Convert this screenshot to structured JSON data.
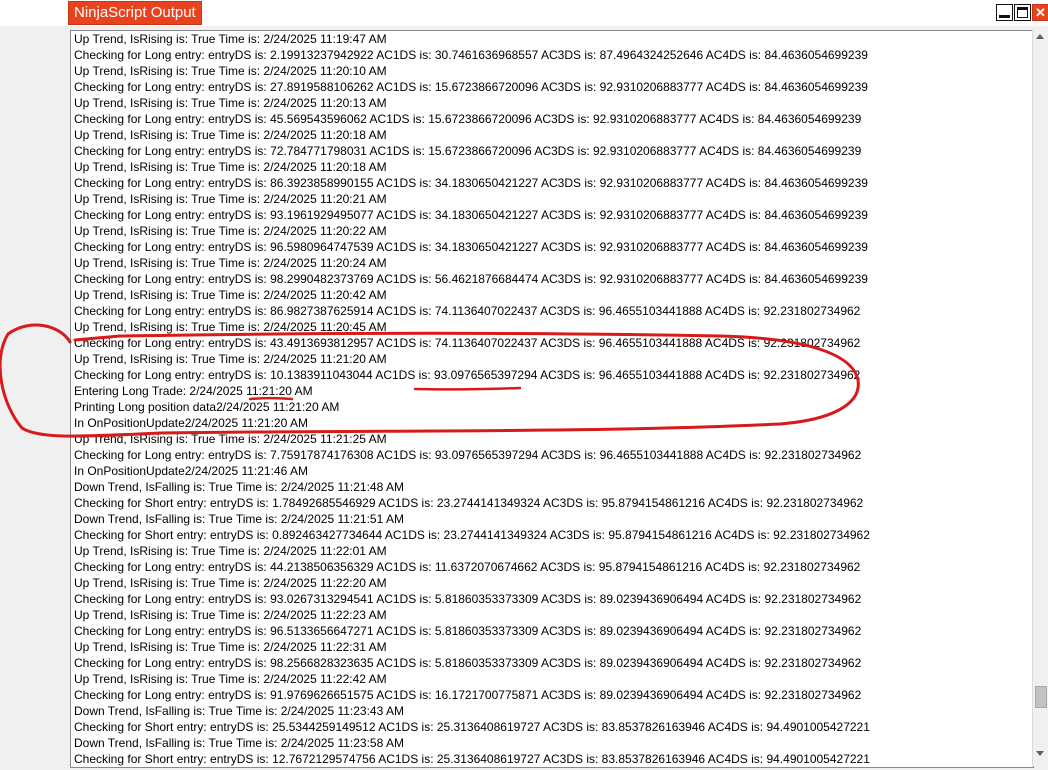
{
  "window": {
    "title": "NinjaScript Output",
    "minimize_symbol": "",
    "maximize_symbol": "",
    "close_symbol": "✕"
  },
  "output": {
    "lines": [
      "Up Trend, IsRising is: True Time is: 2/24/2025 11:19:47 AM",
      "Checking for Long entry: entryDS is: 2.19913237942922 AC1DS is: 30.7461636968557 AC3DS is: 87.4964324252646 AC4DS is: 84.4636054699239",
      "Up Trend, IsRising is: True Time is: 2/24/2025 11:20:10 AM",
      "Checking for Long entry: entryDS is: 27.8919588106262 AC1DS is: 15.6723866720096 AC3DS is: 92.9310206883777 AC4DS is: 84.4636054699239",
      "Up Trend, IsRising is: True Time is: 2/24/2025 11:20:13 AM",
      "Checking for Long entry: entryDS is: 45.569543596062 AC1DS is: 15.6723866720096 AC3DS is: 92.9310206883777 AC4DS is: 84.4636054699239",
      "Up Trend, IsRising is: True Time is: 2/24/2025 11:20:18 AM",
      "Checking for Long entry: entryDS is: 72.784771798031 AC1DS is: 15.6723866720096 AC3DS is: 92.9310206883777 AC4DS is: 84.4636054699239",
      "Up Trend, IsRising is: True Time is: 2/24/2025 11:20:18 AM",
      "Checking for Long entry: entryDS is: 86.3923858990155 AC1DS is: 34.1830650421227 AC3DS is: 92.9310206883777 AC4DS is: 84.4636054699239",
      "Up Trend, IsRising is: True Time is: 2/24/2025 11:20:21 AM",
      "Checking for Long entry: entryDS is: 93.1961929495077 AC1DS is: 34.1830650421227 AC3DS is: 92.9310206883777 AC4DS is: 84.4636054699239",
      "Up Trend, IsRising is: True Time is: 2/24/2025 11:20:22 AM",
      "Checking for Long entry: entryDS is: 96.5980964747539 AC1DS is: 34.1830650421227 AC3DS is: 92.9310206883777 AC4DS is: 84.4636054699239",
      "Up Trend, IsRising is: True Time is: 2/24/2025 11:20:24 AM",
      "Checking for Long entry: entryDS is: 98.2990482373769 AC1DS is: 56.4621876684474 AC3DS is: 92.9310206883777 AC4DS is: 84.4636054699239",
      "Up Trend, IsRising is: True Time is: 2/24/2025 11:20:42 AM",
      "Checking for Long entry: entryDS is: 86.9827387625914 AC1DS is: 74.1136407022437 AC3DS is: 96.4655103441888 AC4DS is: 92.231802734962",
      "Up Trend, IsRising is: True Time is: 2/24/2025 11:20:45 AM",
      "Checking for Long entry: entryDS is: 43.4913693812957 AC1DS is: 74.1136407022437 AC3DS is: 96.4655103441888 AC4DS is: 92.231802734962",
      "Up Trend, IsRising is: True Time is: 2/24/2025 11:21:20 AM",
      "Checking for Long entry: entryDS is: 10.1383911043044 AC1DS is: 93.0976565397294 AC3DS is: 96.4655103441888 AC4DS is: 92.231802734962",
      "Entering Long Trade: 2/24/2025 11:21:20 AM",
      "Printing Long position data2/24/2025 11:21:20 AM",
      "In OnPositionUpdate2/24/2025 11:21:20 AM",
      "Up Trend, IsRising is: True Time is: 2/24/2025 11:21:25 AM",
      "Checking for Long entry: entryDS is: 7.75917874176308 AC1DS is: 93.0976565397294 AC3DS is: 96.4655103441888 AC4DS is: 92.231802734962",
      "In OnPositionUpdate2/24/2025 11:21:46 AM",
      "Down Trend, IsFalling is: True Time is: 2/24/2025 11:21:48 AM",
      "Checking for Short entry: entryDS is: 1.78492685546929 AC1DS is: 23.2744141349324 AC3DS is: 95.8794154861216 AC4DS is: 92.231802734962",
      "Down Trend, IsFalling is: True Time is: 2/24/2025 11:21:51 AM",
      "Checking for Short entry: entryDS is: 0.892463427734644 AC1DS is: 23.2744141349324 AC3DS is: 95.8794154861216 AC4DS is: 92.231802734962",
      "Up Trend, IsRising is: True Time is: 2/24/2025 11:22:01 AM",
      "Checking for Long entry: entryDS is: 44.2138506356329 AC1DS is: 11.6372070674662 AC3DS is: 95.8794154861216 AC4DS is: 92.231802734962",
      "Up Trend, IsRising is: True Time is: 2/24/2025 11:22:20 AM",
      "Checking for Long entry: entryDS is: 93.0267313294541 AC1DS is: 5.81860353373309 AC3DS is: 89.0239436906494 AC4DS is: 92.231802734962",
      "Up Trend, IsRising is: True Time is: 2/24/2025 11:22:23 AM",
      "Checking for Long entry: entryDS is: 96.5133656647271 AC1DS is: 5.81860353373309 AC3DS is: 89.0239436906494 AC4DS is: 92.231802734962",
      "Up Trend, IsRising is: True Time is: 2/24/2025 11:22:31 AM",
      "Checking for Long entry: entryDS is: 98.2566828323635 AC1DS is: 5.81860353373309 AC3DS is: 89.0239436906494 AC4DS is: 92.231802734962",
      "Up Trend, IsRising is: True Time is: 2/24/2025 11:22:42 AM",
      "Checking for Long entry: entryDS is: 91.9769626651575 AC1DS is: 16.1721700775871 AC3DS is: 89.0239436906494 AC4DS is: 92.231802734962",
      "Down Trend, IsFalling is: True Time is: 2/24/2025 11:23:43 AM",
      "Checking for Short entry: entryDS is: 25.5344259149512 AC1DS is: 25.3136408619727 AC3DS is: 83.8537826163946 AC4DS is: 94.4901005427221",
      "Down Trend, IsFalling is: True Time is: 2/24/2025 11:23:58 AM",
      "Checking for Short entry: entryDS is: 12.7672129574756 AC1DS is: 25.3136408619727 AC3DS is: 83.8537826163946 AC4DS is: 94.4901005427221"
    ]
  },
  "scrollbar": {
    "position_fraction": 0.95
  },
  "colors": {
    "accent": "#e8431f",
    "annotation": "#d81a1a"
  }
}
